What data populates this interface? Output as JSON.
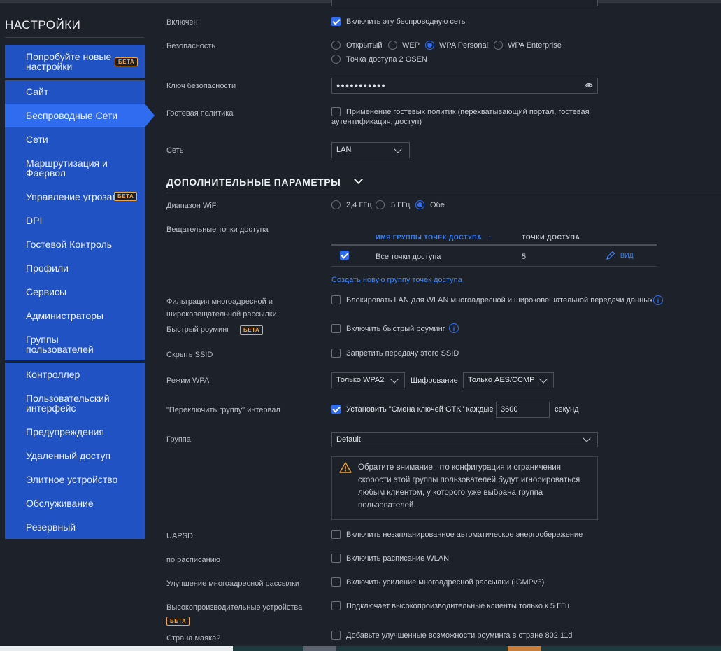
{
  "sidebar": {
    "title": "НАСТРОЙКИ",
    "promo_label": "Попробуйте новые настройки",
    "promo_badge": "БЕТА",
    "items": [
      {
        "label": "Сайт"
      },
      {
        "label": "Беспроводные Сети",
        "active": true
      },
      {
        "label": "Сети"
      },
      {
        "label": "Маршрутизация и Фаервол"
      },
      {
        "label": "Управление угрозами",
        "badge": "БЕТА"
      },
      {
        "label": "DPI"
      },
      {
        "label": "Гостевой Контроль"
      },
      {
        "label": "Профили"
      },
      {
        "label": "Сервисы"
      },
      {
        "label": "Администраторы"
      },
      {
        "label": "Группы пользователей"
      },
      {
        "label": "Контроллер"
      },
      {
        "label": "Пользовательский интерфейс"
      },
      {
        "label": "Предупреждения"
      },
      {
        "label": "Удаленный доступ"
      },
      {
        "label": "Элитное устройство"
      },
      {
        "label": "Обслуживание"
      },
      {
        "label": "Резервный"
      }
    ]
  },
  "form": {
    "enabled": {
      "label": "Включен",
      "checkbox_label": "Включить эту беспроводную сеть",
      "checked": true
    },
    "security": {
      "label": "Безопасность",
      "options": [
        "Открытый",
        "WEP",
        "WPA Personal",
        "WPA Enterprise",
        "Точка доступа 2 OSEN"
      ],
      "selected": "WPA Personal"
    },
    "key": {
      "label": "Ключ безопасности",
      "value": "●●●●●●●●●●●"
    },
    "guest_policy": {
      "label": "Гостевая политика",
      "checkbox_label_1": "Применение гостевых политик (перехватывающий портал, гостевая",
      "checkbox_label_2": "аутентификация, доступ)",
      "checked": false
    },
    "network": {
      "label": "Сеть",
      "value": "LAN"
    }
  },
  "advanced": {
    "title": "ДОПОЛНИТЕЛЬНЫЕ ПАРАМЕТРЫ",
    "wifi_band": {
      "label": "Диапазон WiFi",
      "options": [
        "2,4 ГГц",
        "5 ГГц",
        "Обе"
      ],
      "selected": "Обе"
    },
    "broadcast_aps": {
      "label": "Вещательные точки доступа",
      "col_group": "ИМЯ ГРУППЫ ТОЧЕК ДОСТУПА",
      "col_sort": "↑",
      "col_aps": "ТОЧКИ ДОСТУПА",
      "rows": [
        {
          "name": "Все точки доступа",
          "count": "5",
          "action": "ВИД"
        }
      ],
      "create_link": "Создать новую группу точек доступа"
    },
    "multicast_filter": {
      "label_1": "Фильтрация многоадресной и",
      "label_2": "широковещательной рассылки",
      "checkbox_label": "Блокировать LAN для WLAN многоадресной и широковещательной передачи данных"
    },
    "fast_roaming": {
      "label": "Быстрый роуминг",
      "badge": "БЕТА",
      "checkbox_label": "Включить быстрый роуминг"
    },
    "hide_ssid": {
      "label": "Скрыть SSID",
      "checkbox_label": "Запретить передачу этого SSID"
    },
    "wpa_mode": {
      "label": "Режим WPA",
      "value": "Только WPA2",
      "encryption_label": "Шифрование",
      "encryption_value": "Только AES/CCMP"
    },
    "gtk_interval": {
      "label": "\"Переключить группу\" интервал",
      "checkbox_label": "Установить \"Смена ключей GTK\" каждые",
      "value": "3600",
      "unit": "секунд"
    },
    "group": {
      "label": "Группа",
      "value": "Default",
      "warning_1": "Обратите внимание, что конфигурация и ограничения",
      "warning_2": "скорости этой группы пользователей будут игнорироваться",
      "warning_3": "любым клиентом, у которого уже выбрана группа",
      "warning_4": "пользователей."
    },
    "uapsd": {
      "label": "UAPSD",
      "checkbox_label": "Включить незапланированное автоматическое энергосбережение"
    },
    "schedule": {
      "label": "по расписанию",
      "checkbox_label": "Включить расписание WLAN"
    },
    "multicast_enh": {
      "label": "Улучшение многоадресной рассылки",
      "checkbox_label": "Включить усиление многоадресной рассылки (IGMPv3)"
    },
    "high_perf": {
      "label": "Высокопроизводительные устройства",
      "badge": "БЕТА",
      "checkbox_label": "Подключает высокопроизводительные клиенты только к 5 ГГц"
    },
    "beacon_country": {
      "label": "Страна маяка?",
      "checkbox_label": "Добавьте улучшенные возможности роуминга в стране 802.11d"
    }
  },
  "colors": {
    "accent": "#2f6cf0",
    "sidebar": "#2152c4",
    "beta": "#f0a640",
    "background": "#1d212a"
  }
}
